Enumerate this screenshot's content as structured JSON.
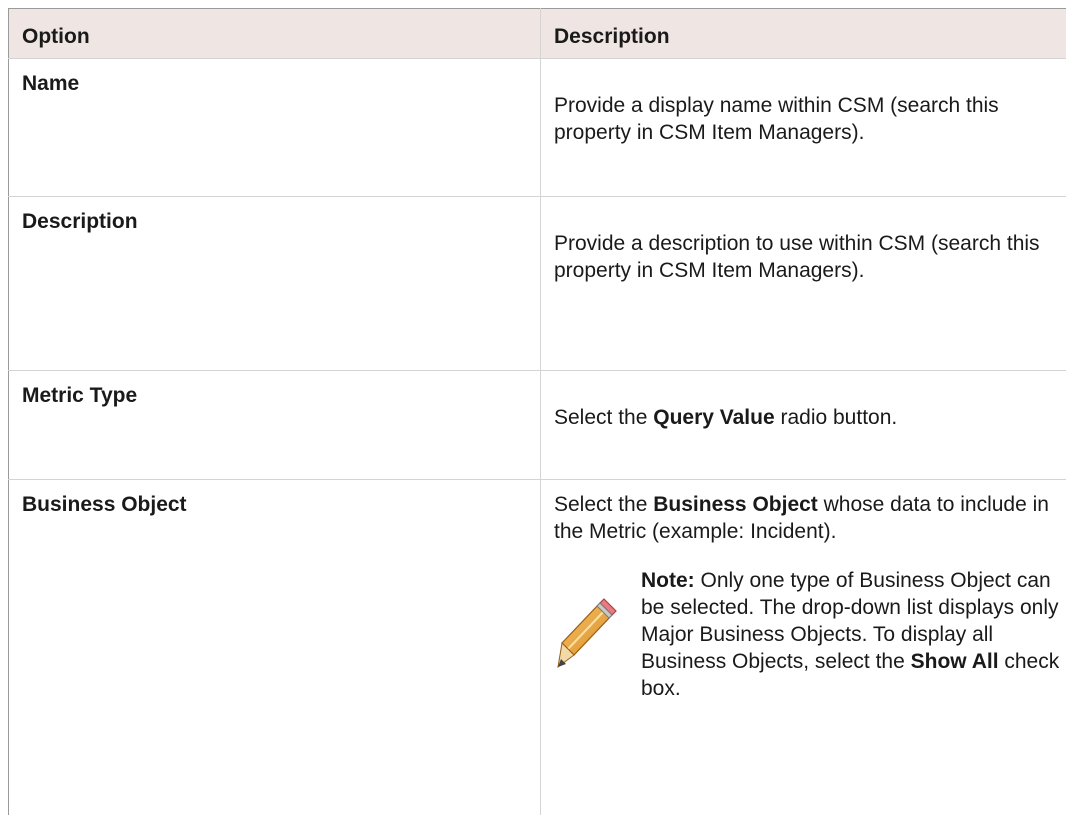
{
  "header": {
    "option": "Option",
    "description": "Description"
  },
  "rows": [
    {
      "option": "Name",
      "description": "Provide a display name within CSM (search this property in CSM Item Managers)."
    },
    {
      "option": "Description",
      "description": "Provide a description to use within CSM (search this property in CSM Item Managers)."
    },
    {
      "option": "Metric Type",
      "desc_pre": "Select the ",
      "desc_bold": "Query Value",
      "desc_post": " radio button."
    },
    {
      "option": "Business Object",
      "desc_pre": "Select the ",
      "desc_bold": "Business Object",
      "desc_post": " whose data to include in the Metric (example: Incident).",
      "note": {
        "icon": "pencil-icon",
        "label": "Note:",
        "text": " Only one type of Business Object can be selected. The drop-down list displays only Major Business Objects. To display all Business Objects, select the ",
        "bold": "Show All",
        "text_end": " check box."
      }
    }
  ]
}
